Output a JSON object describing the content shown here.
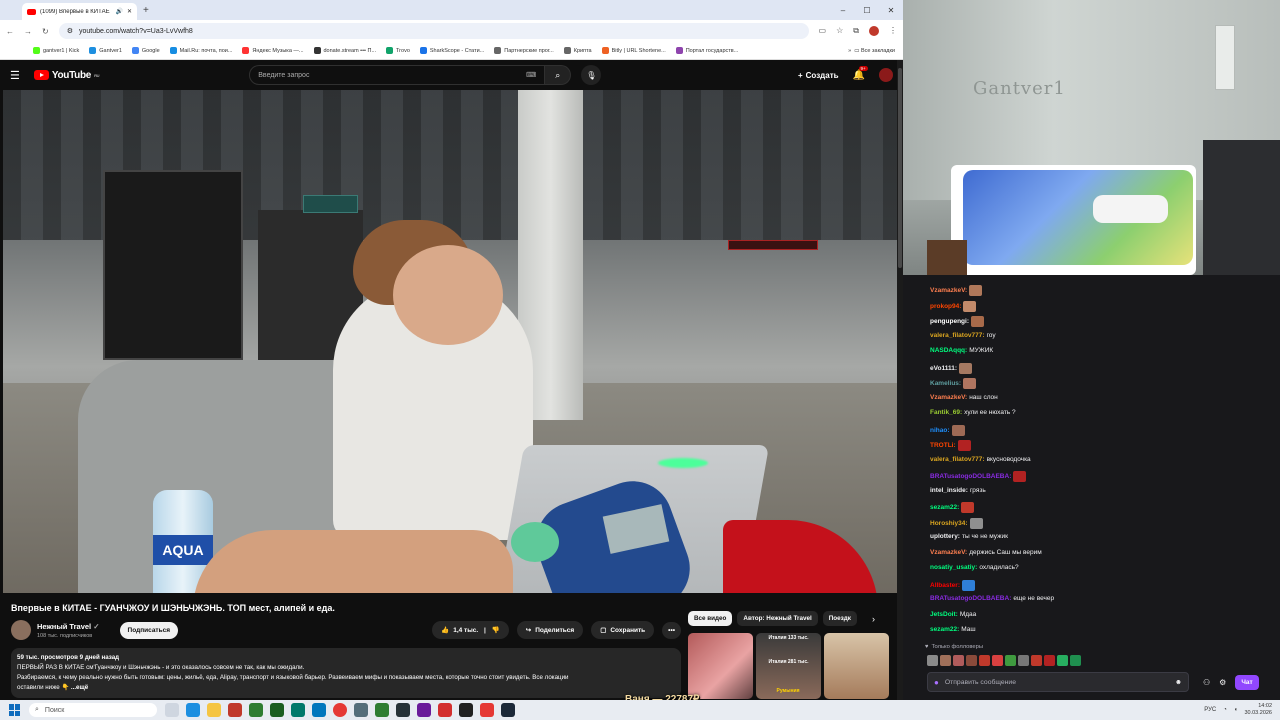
{
  "browser": {
    "tab_title": "(1099) Впервые в КИТАЕ",
    "url": "youtube.com/watch?v=Ua3-LvVwfh8",
    "win_min": "–",
    "win_max": "☐",
    "win_close": "✕",
    "newtab": "+",
    "bookmarks": [
      "gantver1 | Kick",
      "Gantver1",
      "Google",
      "Mail.Ru: почта, пои...",
      "Яндекс Музыка —...",
      "donate.stream ••• П...",
      "Trovo",
      "SharkScope - Стати...",
      "Партнерские прог...",
      "Крипта",
      "Bitly | URL Shortene...",
      "Портал государств..."
    ],
    "bookmarks_more": "»",
    "all_bookmarks": "Все закладки"
  },
  "youtube": {
    "logo_text": "YouTube",
    "logo_region": "RU",
    "search_placeholder": "Введите запрос",
    "create_label": "Создать",
    "notif_count": "9+",
    "video_title": "Впервые в КИТАЕ - ГУАНЧЖОУ И ШЭНЬЧЖЭНЬ. ТОП мест, алипей и еда.",
    "channel_name": "Нежный Travel",
    "channel_subs": "108 тыс. подписчиков",
    "subscribe_label": "Подписаться",
    "likes": "1,4 тыс.",
    "share_label": "Поделиться",
    "save_label": "Сохранить",
    "more_label": "•••",
    "views_date": "59 тыс. просмотров  9 дней назад",
    "desc_line1": "ПЕРВЫЙ РАЗ В КИТАЕ см'Гуанчжоу и Шэньчжэнь - и это оказалось совсем не так, как мы ожидали.",
    "desc_line2": "Разбираемся, к чему реально нужно быть готовым: цены, жильё, еда, Alipay, транспорт и языковой барьер. Развеиваем мифы и показываем места, которые точно стоит увидеть. Все локации",
    "desc_line3": "оставили ниже 👇",
    "desc_more": "...ещё",
    "chips": [
      "Все видео",
      "Автор: Нежный Travel",
      "Поездк"
    ],
    "thumb2_label": "Италия 133 тыс.",
    "thumb2_label2": "Италия 281 тыс.",
    "thumb2_label3": "Румыния"
  },
  "webcam": {
    "wall_text": "Gantver1"
  },
  "chat": {
    "messages": [
      {
        "nick": "VzamazkeV:",
        "color": "#ff7f50",
        "text": "",
        "emote": "#b0785a"
      },
      {
        "nick": "prokop94:",
        "color": "#ff4500",
        "text": "",
        "emote": "#c28a6a"
      },
      {
        "nick": "pengupengi:",
        "color": "#ffffff",
        "text": "",
        "emote": "#a86a4a"
      },
      {
        "nick": "valera_filatov777:",
        "color": "#daa520",
        "text": "гоу",
        "emote": ""
      },
      {
        "nick": "NASDAqqq:",
        "color": "#00ff7f",
        "text": "МУЖИК",
        "emote": ""
      },
      {
        "nick": "eVo1111:",
        "color": "#efeff1",
        "text": "",
        "emote": "#a57962"
      },
      {
        "nick": "Kamelius:",
        "color": "#5f9ea0",
        "text": "",
        "emote": "#b07560"
      },
      {
        "nick": "VzamazkeV:",
        "color": "#ff7f50",
        "text": "наш слон",
        "emote": ""
      },
      {
        "nick": "Fantik_69:",
        "color": "#9acd32",
        "text": "хули ее нюхать ?",
        "emote": ""
      },
      {
        "nick": "nihao:",
        "color": "#1e90ff",
        "text": "",
        "emote": "#9e6a55"
      },
      {
        "nick": "TROTLi:",
        "color": "#ff4500",
        "text": "",
        "emote": "#b22222"
      },
      {
        "nick": "valera_filatov777:",
        "color": "#daa520",
        "text": "вкусноводочка",
        "emote": ""
      },
      {
        "nick": "BRATusatogoDOLBAEBA:",
        "color": "#8a2be2",
        "text": "",
        "emote": "#b22222"
      },
      {
        "nick": "intel_inside:",
        "color": "#efeff1",
        "text": "грязь",
        "emote": ""
      },
      {
        "nick": "sezam22:",
        "color": "#00ff7f",
        "text": "",
        "emote": "#c0392b"
      },
      {
        "nick": "Horoshiy34:",
        "color": "#daa520",
        "text": "",
        "emote": "#8f8f8f"
      },
      {
        "nick": "uplottery:",
        "color": "#efeff1",
        "text": "ты че не мужик",
        "emote": ""
      },
      {
        "nick": "VzamazkeV:",
        "color": "#ff7f50",
        "text": "держись Саш мы верим",
        "emote": ""
      },
      {
        "nick": "nosatiy_usatiy:",
        "color": "#00ff7f",
        "text": "охладилась?",
        "emote": ""
      },
      {
        "nick": "Allbaster:",
        "color": "#ff0000",
        "text": "",
        "emote": "#2f7fd8"
      },
      {
        "nick": "BRATusatogoDOLBAEBA:",
        "color": "#8a2be2",
        "text": "еще не вечер",
        "emote": ""
      },
      {
        "nick": "JetsDoit:",
        "color": "#00ff7f",
        "text": "Мдаа",
        "emote": ""
      },
      {
        "nick": "sezam22:",
        "color": "#00ff7f",
        "text": "Маш",
        "emote": ""
      }
    ],
    "followers_only": "Только фолловеры",
    "input_placeholder": "Отправить сообщение",
    "chat_button": "Чат",
    "emotebar_colors": [
      "#8a8a8a",
      "#a0705a",
      "#b05b5b",
      "#8a4a3a",
      "#c0392b",
      "#d84040",
      "#3f9a3f",
      "#777",
      "#c0392b",
      "#b22222",
      "#27ae60",
      "#1f8f4f"
    ]
  },
  "overlay_text": "Ваня — 22787₽",
  "taskbar": {
    "search_label": "Поиск",
    "lang": "РУС",
    "time": "14:02",
    "date": "30.03.2026"
  }
}
